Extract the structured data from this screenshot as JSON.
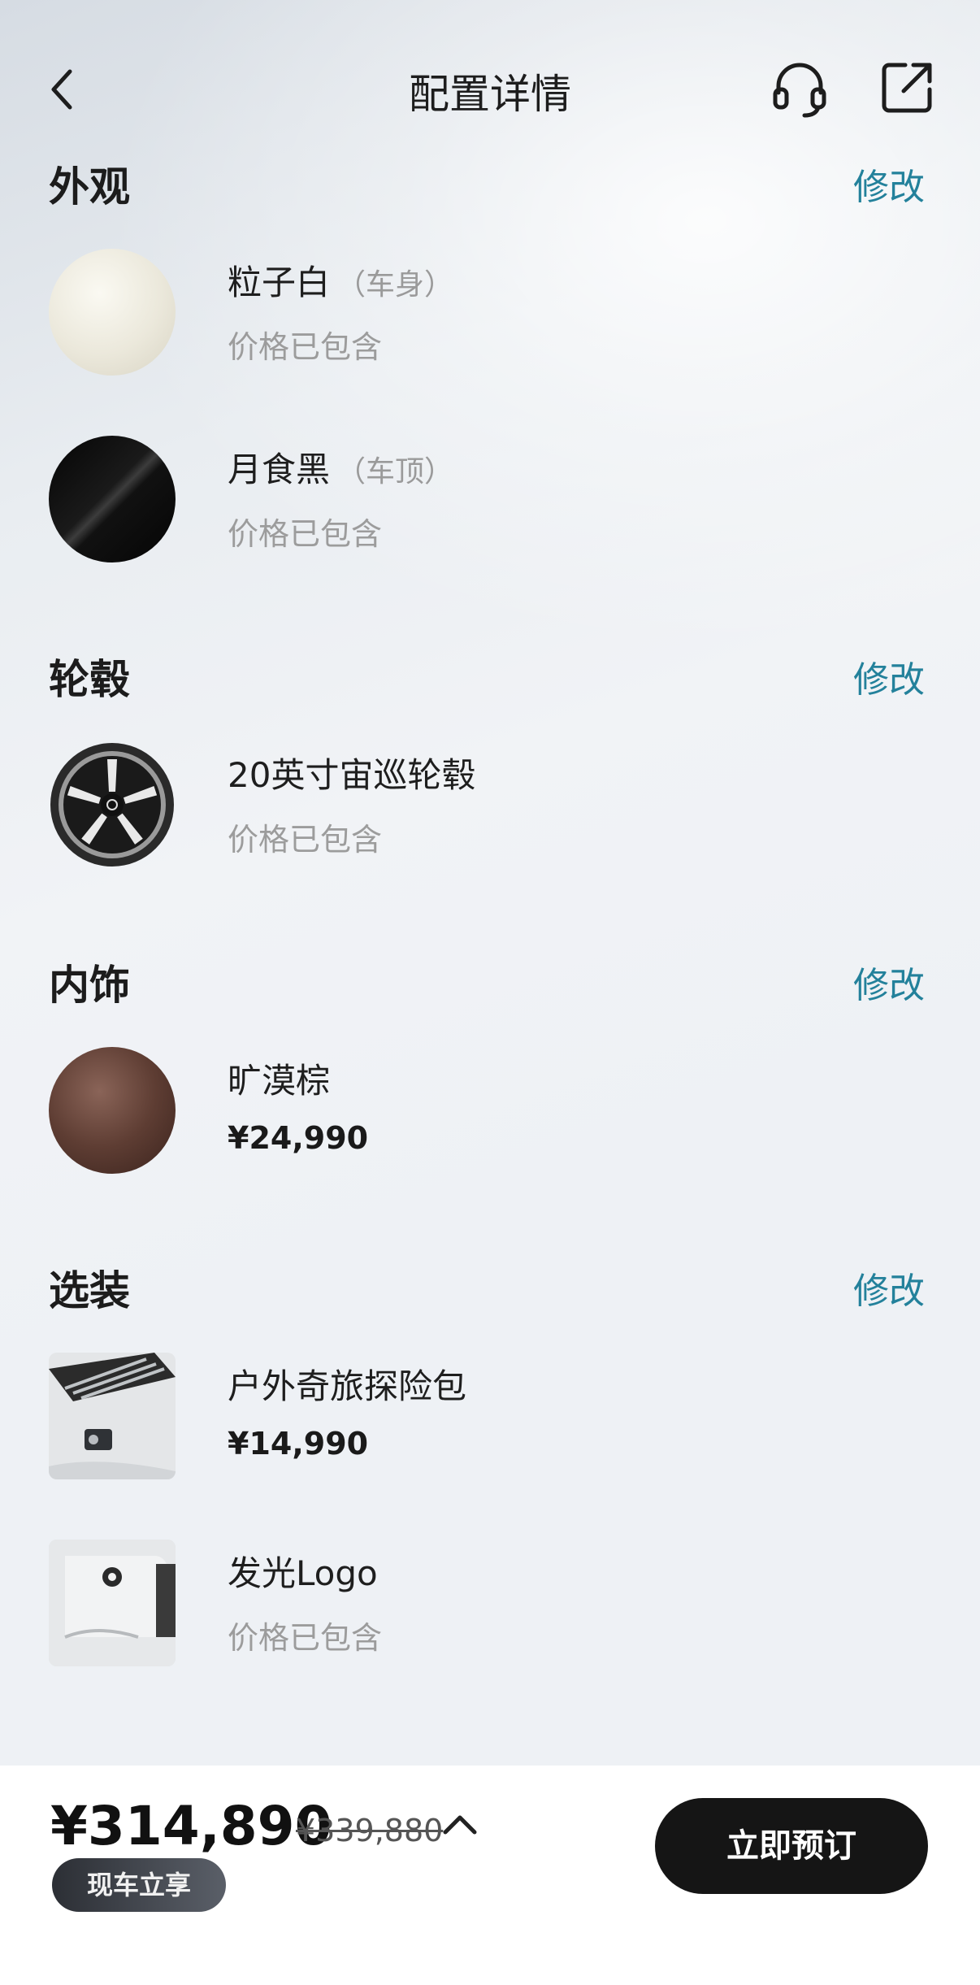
{
  "header": {
    "title": "配置详情",
    "icons": {
      "back": "chevron-left-icon",
      "service": "headset-icon",
      "share": "share-external-icon"
    }
  },
  "sections": {
    "exterior": {
      "title": "外观",
      "edit": "修改",
      "items": [
        {
          "name": "粒子白",
          "sub": "（车身）",
          "price": "价格已包含",
          "swatch": "#ece9dd"
        },
        {
          "name": "月食黑",
          "sub": "（车顶）",
          "price": "价格已包含",
          "swatch": "#111111"
        }
      ]
    },
    "wheels": {
      "title": "轮毂",
      "edit": "修改",
      "items": [
        {
          "name": "20英寸宙巡轮毂",
          "price": "价格已包含"
        }
      ]
    },
    "interior": {
      "title": "内饰",
      "edit": "修改",
      "items": [
        {
          "name": "旷漠棕",
          "price": "¥24,990",
          "swatch": "#5a3a30"
        }
      ]
    },
    "options": {
      "title": "选装",
      "edit": "修改",
      "items": [
        {
          "name": "户外奇旅探险包",
          "price": "¥14,990"
        },
        {
          "name": "发光Logo",
          "price": "价格已包含"
        }
      ]
    }
  },
  "footer": {
    "total": "¥314,890",
    "original": "¥339,880",
    "badge": "现车立享",
    "cta": "立即预订"
  },
  "colors": {
    "accent": "#23819b",
    "cta": "#151515"
  }
}
